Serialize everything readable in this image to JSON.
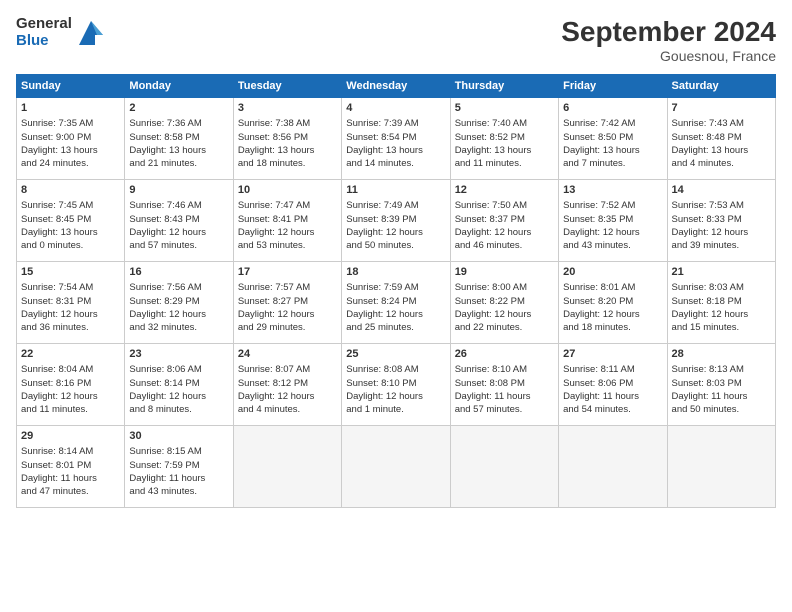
{
  "logo": {
    "line1": "General",
    "line2": "Blue"
  },
  "title": "September 2024",
  "subtitle": "Gouesnou, France",
  "weekdays": [
    "Sunday",
    "Monday",
    "Tuesday",
    "Wednesday",
    "Thursday",
    "Friday",
    "Saturday"
  ],
  "weeks": [
    [
      {
        "day": "1",
        "lines": [
          "Sunrise: 7:35 AM",
          "Sunset: 9:00 PM",
          "Daylight: 13 hours",
          "and 24 minutes."
        ]
      },
      {
        "day": "2",
        "lines": [
          "Sunrise: 7:36 AM",
          "Sunset: 8:58 PM",
          "Daylight: 13 hours",
          "and 21 minutes."
        ]
      },
      {
        "day": "3",
        "lines": [
          "Sunrise: 7:38 AM",
          "Sunset: 8:56 PM",
          "Daylight: 13 hours",
          "and 18 minutes."
        ]
      },
      {
        "day": "4",
        "lines": [
          "Sunrise: 7:39 AM",
          "Sunset: 8:54 PM",
          "Daylight: 13 hours",
          "and 14 minutes."
        ]
      },
      {
        "day": "5",
        "lines": [
          "Sunrise: 7:40 AM",
          "Sunset: 8:52 PM",
          "Daylight: 13 hours",
          "and 11 minutes."
        ]
      },
      {
        "day": "6",
        "lines": [
          "Sunrise: 7:42 AM",
          "Sunset: 8:50 PM",
          "Daylight: 13 hours",
          "and 7 minutes."
        ]
      },
      {
        "day": "7",
        "lines": [
          "Sunrise: 7:43 AM",
          "Sunset: 8:48 PM",
          "Daylight: 13 hours",
          "and 4 minutes."
        ]
      }
    ],
    [
      {
        "day": "8",
        "lines": [
          "Sunrise: 7:45 AM",
          "Sunset: 8:45 PM",
          "Daylight: 13 hours",
          "and 0 minutes."
        ]
      },
      {
        "day": "9",
        "lines": [
          "Sunrise: 7:46 AM",
          "Sunset: 8:43 PM",
          "Daylight: 12 hours",
          "and 57 minutes."
        ]
      },
      {
        "day": "10",
        "lines": [
          "Sunrise: 7:47 AM",
          "Sunset: 8:41 PM",
          "Daylight: 12 hours",
          "and 53 minutes."
        ]
      },
      {
        "day": "11",
        "lines": [
          "Sunrise: 7:49 AM",
          "Sunset: 8:39 PM",
          "Daylight: 12 hours",
          "and 50 minutes."
        ]
      },
      {
        "day": "12",
        "lines": [
          "Sunrise: 7:50 AM",
          "Sunset: 8:37 PM",
          "Daylight: 12 hours",
          "and 46 minutes."
        ]
      },
      {
        "day": "13",
        "lines": [
          "Sunrise: 7:52 AM",
          "Sunset: 8:35 PM",
          "Daylight: 12 hours",
          "and 43 minutes."
        ]
      },
      {
        "day": "14",
        "lines": [
          "Sunrise: 7:53 AM",
          "Sunset: 8:33 PM",
          "Daylight: 12 hours",
          "and 39 minutes."
        ]
      }
    ],
    [
      {
        "day": "15",
        "lines": [
          "Sunrise: 7:54 AM",
          "Sunset: 8:31 PM",
          "Daylight: 12 hours",
          "and 36 minutes."
        ]
      },
      {
        "day": "16",
        "lines": [
          "Sunrise: 7:56 AM",
          "Sunset: 8:29 PM",
          "Daylight: 12 hours",
          "and 32 minutes."
        ]
      },
      {
        "day": "17",
        "lines": [
          "Sunrise: 7:57 AM",
          "Sunset: 8:27 PM",
          "Daylight: 12 hours",
          "and 29 minutes."
        ]
      },
      {
        "day": "18",
        "lines": [
          "Sunrise: 7:59 AM",
          "Sunset: 8:24 PM",
          "Daylight: 12 hours",
          "and 25 minutes."
        ]
      },
      {
        "day": "19",
        "lines": [
          "Sunrise: 8:00 AM",
          "Sunset: 8:22 PM",
          "Daylight: 12 hours",
          "and 22 minutes."
        ]
      },
      {
        "day": "20",
        "lines": [
          "Sunrise: 8:01 AM",
          "Sunset: 8:20 PM",
          "Daylight: 12 hours",
          "and 18 minutes."
        ]
      },
      {
        "day": "21",
        "lines": [
          "Sunrise: 8:03 AM",
          "Sunset: 8:18 PM",
          "Daylight: 12 hours",
          "and 15 minutes."
        ]
      }
    ],
    [
      {
        "day": "22",
        "lines": [
          "Sunrise: 8:04 AM",
          "Sunset: 8:16 PM",
          "Daylight: 12 hours",
          "and 11 minutes."
        ]
      },
      {
        "day": "23",
        "lines": [
          "Sunrise: 8:06 AM",
          "Sunset: 8:14 PM",
          "Daylight: 12 hours",
          "and 8 minutes."
        ]
      },
      {
        "day": "24",
        "lines": [
          "Sunrise: 8:07 AM",
          "Sunset: 8:12 PM",
          "Daylight: 12 hours",
          "and 4 minutes."
        ]
      },
      {
        "day": "25",
        "lines": [
          "Sunrise: 8:08 AM",
          "Sunset: 8:10 PM",
          "Daylight: 12 hours",
          "and 1 minute."
        ]
      },
      {
        "day": "26",
        "lines": [
          "Sunrise: 8:10 AM",
          "Sunset: 8:08 PM",
          "Daylight: 11 hours",
          "and 57 minutes."
        ]
      },
      {
        "day": "27",
        "lines": [
          "Sunrise: 8:11 AM",
          "Sunset: 8:06 PM",
          "Daylight: 11 hours",
          "and 54 minutes."
        ]
      },
      {
        "day": "28",
        "lines": [
          "Sunrise: 8:13 AM",
          "Sunset: 8:03 PM",
          "Daylight: 11 hours",
          "and 50 minutes."
        ]
      }
    ],
    [
      {
        "day": "29",
        "lines": [
          "Sunrise: 8:14 AM",
          "Sunset: 8:01 PM",
          "Daylight: 11 hours",
          "and 47 minutes."
        ]
      },
      {
        "day": "30",
        "lines": [
          "Sunrise: 8:15 AM",
          "Sunset: 7:59 PM",
          "Daylight: 11 hours",
          "and 43 minutes."
        ]
      },
      {
        "day": "",
        "lines": []
      },
      {
        "day": "",
        "lines": []
      },
      {
        "day": "",
        "lines": []
      },
      {
        "day": "",
        "lines": []
      },
      {
        "day": "",
        "lines": []
      }
    ]
  ]
}
